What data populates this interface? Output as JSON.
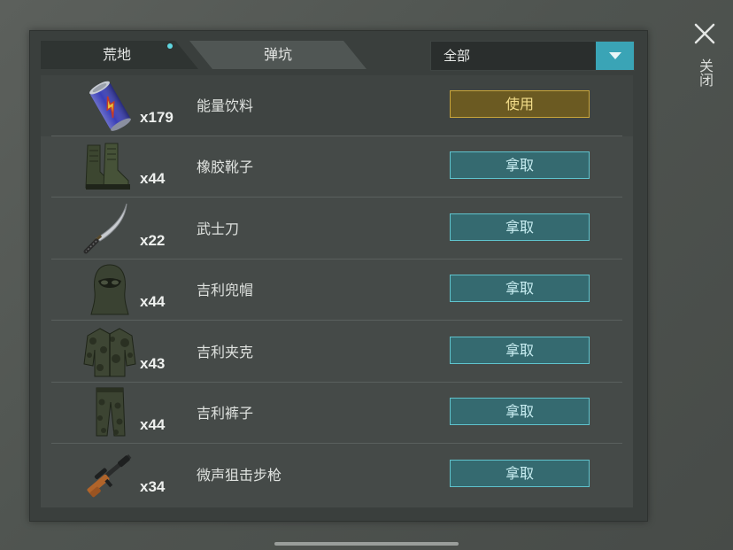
{
  "tabs": [
    {
      "label": "荒地",
      "active": true
    },
    {
      "label": "弹坑",
      "active": false
    }
  ],
  "filter": {
    "value": "全部"
  },
  "close": {
    "label": "关闭"
  },
  "colors": {
    "accent": "#3aa4b6",
    "use_button": "#c9a53a",
    "take_button": "#5fc3cd"
  },
  "items": [
    {
      "name": "能量饮料",
      "count": "x179",
      "action": "使用",
      "icon": "energy-drink-icon"
    },
    {
      "name": "橡胶靴子",
      "count": "x44",
      "action": "拿取",
      "icon": "rubber-boots-icon"
    },
    {
      "name": "武士刀",
      "count": "x22",
      "action": "拿取",
      "icon": "katana-icon"
    },
    {
      "name": "吉利兜帽",
      "count": "x44",
      "action": "拿取",
      "icon": "ghillie-hood-icon"
    },
    {
      "name": "吉利夹克",
      "count": "x43",
      "action": "拿取",
      "icon": "ghillie-jacket-icon"
    },
    {
      "name": "吉利裤子",
      "count": "x44",
      "action": "拿取",
      "icon": "ghillie-pants-icon"
    },
    {
      "name": "微声狙击步枪",
      "count": "x34",
      "action": "拿取",
      "icon": "silenced-sniper-rifle-icon"
    }
  ]
}
